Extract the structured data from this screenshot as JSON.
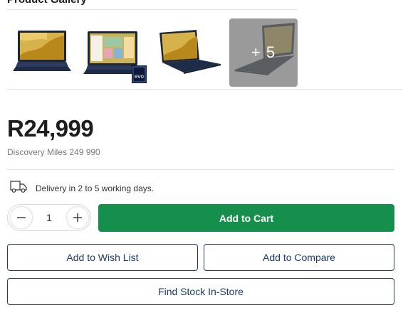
{
  "gallery": {
    "title": "Product Gallery",
    "thumbnails": [
      {
        "icon": "laptop-front-image"
      },
      {
        "icon": "laptop-screen-evo-image",
        "badge": "evo"
      },
      {
        "icon": "laptop-angle-image"
      },
      {
        "icon": "laptop-dark-image",
        "overlay": "+ 5"
      }
    ]
  },
  "product": {
    "price": "R24,999",
    "discovery_miles": "Discovery Miles 249 990"
  },
  "delivery": {
    "icon": "delivery-truck-icon",
    "text": "Delivery in 2 to 5 working days."
  },
  "quantity": {
    "value": "1",
    "minus_icon": "minus-icon",
    "plus_icon": "plus-icon"
  },
  "actions": {
    "add_to_cart": "Add to Cart",
    "add_to_wishlist": "Add to Wish List",
    "add_to_compare": "Add to Compare",
    "find_stock": "Find Stock In-Store"
  },
  "colors": {
    "primary_green": "#158f4b",
    "outline_navy": "#1f3a68",
    "price_text": "#1e1e1e"
  }
}
